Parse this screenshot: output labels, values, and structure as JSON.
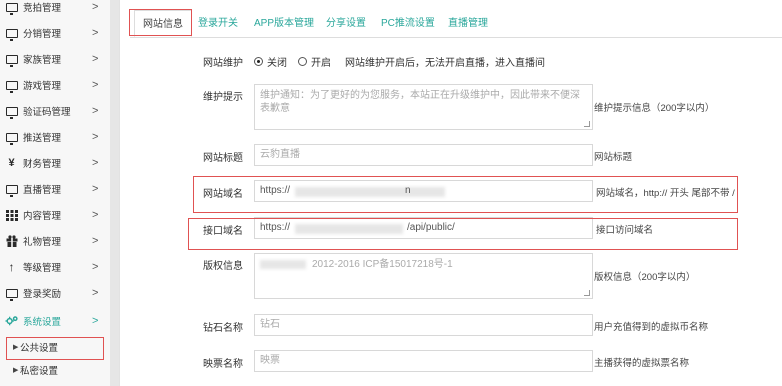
{
  "sidebar": {
    "items": [
      {
        "label": "竞拍管理",
        "icon": "monitor-icon"
      },
      {
        "label": "分销管理",
        "icon": "monitor-icon"
      },
      {
        "label": "家族管理",
        "icon": "monitor-icon"
      },
      {
        "label": "游戏管理",
        "icon": "monitor-icon"
      },
      {
        "label": "验证码管理",
        "icon": "monitor-icon"
      },
      {
        "label": "推送管理",
        "icon": "monitor-icon"
      },
      {
        "label": "财务管理",
        "icon": "yen-icon"
      },
      {
        "label": "直播管理",
        "icon": "monitor-icon"
      },
      {
        "label": "内容管理",
        "icon": "grid-icon"
      },
      {
        "label": "礼物管理",
        "icon": "gift-icon"
      },
      {
        "label": "等级管理",
        "icon": "arrow-up-icon"
      },
      {
        "label": "登录奖励",
        "icon": "monitor-icon"
      },
      {
        "label": "系统设置",
        "icon": "gears-icon"
      }
    ],
    "sub_items": [
      {
        "label": "公共设置"
      },
      {
        "label": "私密设置"
      }
    ],
    "chevron": ">",
    "active_color": "#2aa79b"
  },
  "tabs": [
    "网站信息",
    "登录开关",
    "APP版本管理",
    "分享设置",
    "PC推流设置",
    "直播管理"
  ],
  "form": {
    "maintenance": {
      "label": "网站维护",
      "option_off": "关闭",
      "option_on": "开启",
      "selected": "关闭",
      "note": "网站维护开启后，无法开启直播，进入直播间"
    },
    "tip": {
      "label": "维护提示",
      "placeholder": "维护通知：为了更好的为您服务，本站正在升级维护中，因此带来不便深表歉意",
      "help": "维护提示信息（200字以内）"
    },
    "title": {
      "label": "网站标题",
      "value": "云豹直播",
      "help": "网站标题"
    },
    "domain": {
      "label": "网站域名",
      "value": "https://",
      "suffix": "n",
      "help": "网站域名，http:// 开头 尾部不带 /"
    },
    "api": {
      "label": "接口域名",
      "value": "https://",
      "suffix": "/api/public/",
      "help": "接口访问域名"
    },
    "copyright": {
      "label": "版权信息",
      "value": "2012-2016 ICP备15017218号-1",
      "help": "版权信息（200字以内）"
    },
    "diamond": {
      "label": "钻石名称",
      "value": "钻石",
      "help": "用户充值得到的虚拟币名称"
    },
    "ticket": {
      "label": "映票名称",
      "value": "映票",
      "help": "主播获得的虚拟票名称"
    }
  }
}
